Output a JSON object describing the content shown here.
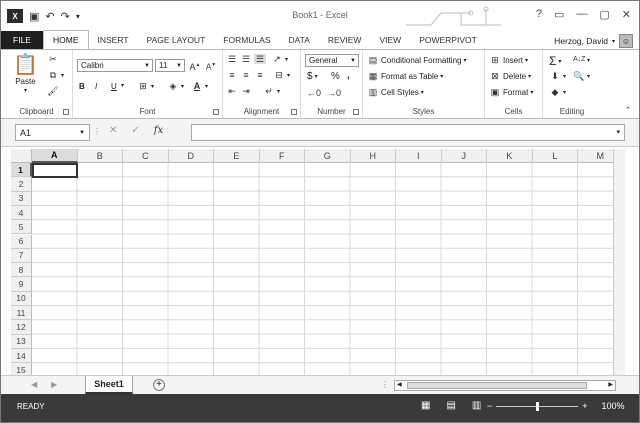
{
  "window": {
    "title": "Book1 - Excel",
    "logo": "X",
    "controls": [
      "?",
      "▭",
      "—",
      "▢",
      "✕"
    ]
  },
  "qat": {
    "save_icon": "💾",
    "undo": "↶",
    "redo": "↷",
    "customize": "▾"
  },
  "tabs": [
    "FILE",
    "HOME",
    "INSERT",
    "PAGE LAYOUT",
    "FORMULAS",
    "DATA",
    "REVIEW",
    "VIEW",
    "POWERPIVOT"
  ],
  "active_tab": "HOME",
  "user": {
    "name": "Herzog, David"
  },
  "ribbon": {
    "clipboard": {
      "label": "Clipboard",
      "paste": "Paste"
    },
    "font": {
      "label": "Font",
      "name": "Calibri",
      "size": "11",
      "bold": "B",
      "italic": "I",
      "underline": "U"
    },
    "alignment": {
      "label": "Alignment"
    },
    "number": {
      "label": "Number",
      "format": "General",
      "currency": "$",
      "percent": "%",
      "comma": ","
    },
    "styles": {
      "label": "Styles",
      "conditional": "Conditional Formatting",
      "table": "Format as Table",
      "cell": "Cell Styles"
    },
    "cells": {
      "label": "Cells",
      "insert": "Insert",
      "delete": "Delete",
      "format": "Format"
    },
    "editing": {
      "label": "Editing"
    }
  },
  "formula_bar": {
    "name_box": "A1",
    "cancel": "✕",
    "enter": "✓",
    "fx": "fx",
    "value": ""
  },
  "columns": [
    "A",
    "B",
    "C",
    "D",
    "E",
    "F",
    "G",
    "H",
    "I",
    "J",
    "K",
    "L",
    "M"
  ],
  "rows": [
    "1",
    "2",
    "3",
    "4",
    "5",
    "6",
    "7",
    "8",
    "9",
    "10",
    "11",
    "12",
    "13",
    "14",
    "15"
  ],
  "sheets": {
    "active": "Sheet1",
    "add": "+"
  },
  "status": {
    "mode": "READY",
    "zoom": "100%",
    "zoom_minus": "−",
    "zoom_plus": "+"
  }
}
